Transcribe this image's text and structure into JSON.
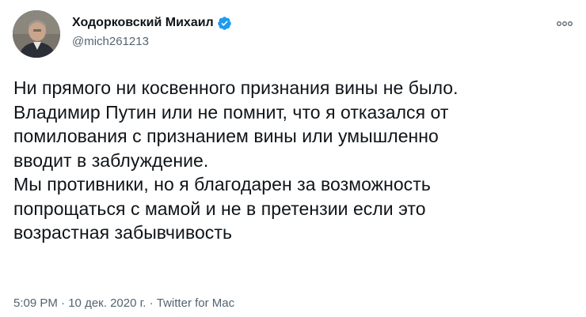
{
  "author": {
    "name": "Ходорковский Михаил",
    "handle": "@mich261213",
    "verified": true
  },
  "tweet": {
    "lines": [
      "Ни прямого ни косвенного признания вины не было.",
      "Владимир Путин или не помнит, что я отказался от",
      "помилования с признанием вины или умышленно",
      "вводит в заблуждение.",
      "Мы противники, но я благодарен за возможность",
      "попрощаться с мамой и не в претензии если это",
      "возрастная забывчивость"
    ]
  },
  "meta": {
    "time": "5:09 PM",
    "separator": " · ",
    "date": "10 дек. 2020 г.",
    "source": "Twitter for Mac"
  },
  "icons": {
    "verified": "verified-badge-icon",
    "more": "more-options-icon"
  },
  "colors": {
    "text": "#0f1419",
    "secondary": "#536471",
    "verified": "#1d9bf0"
  }
}
